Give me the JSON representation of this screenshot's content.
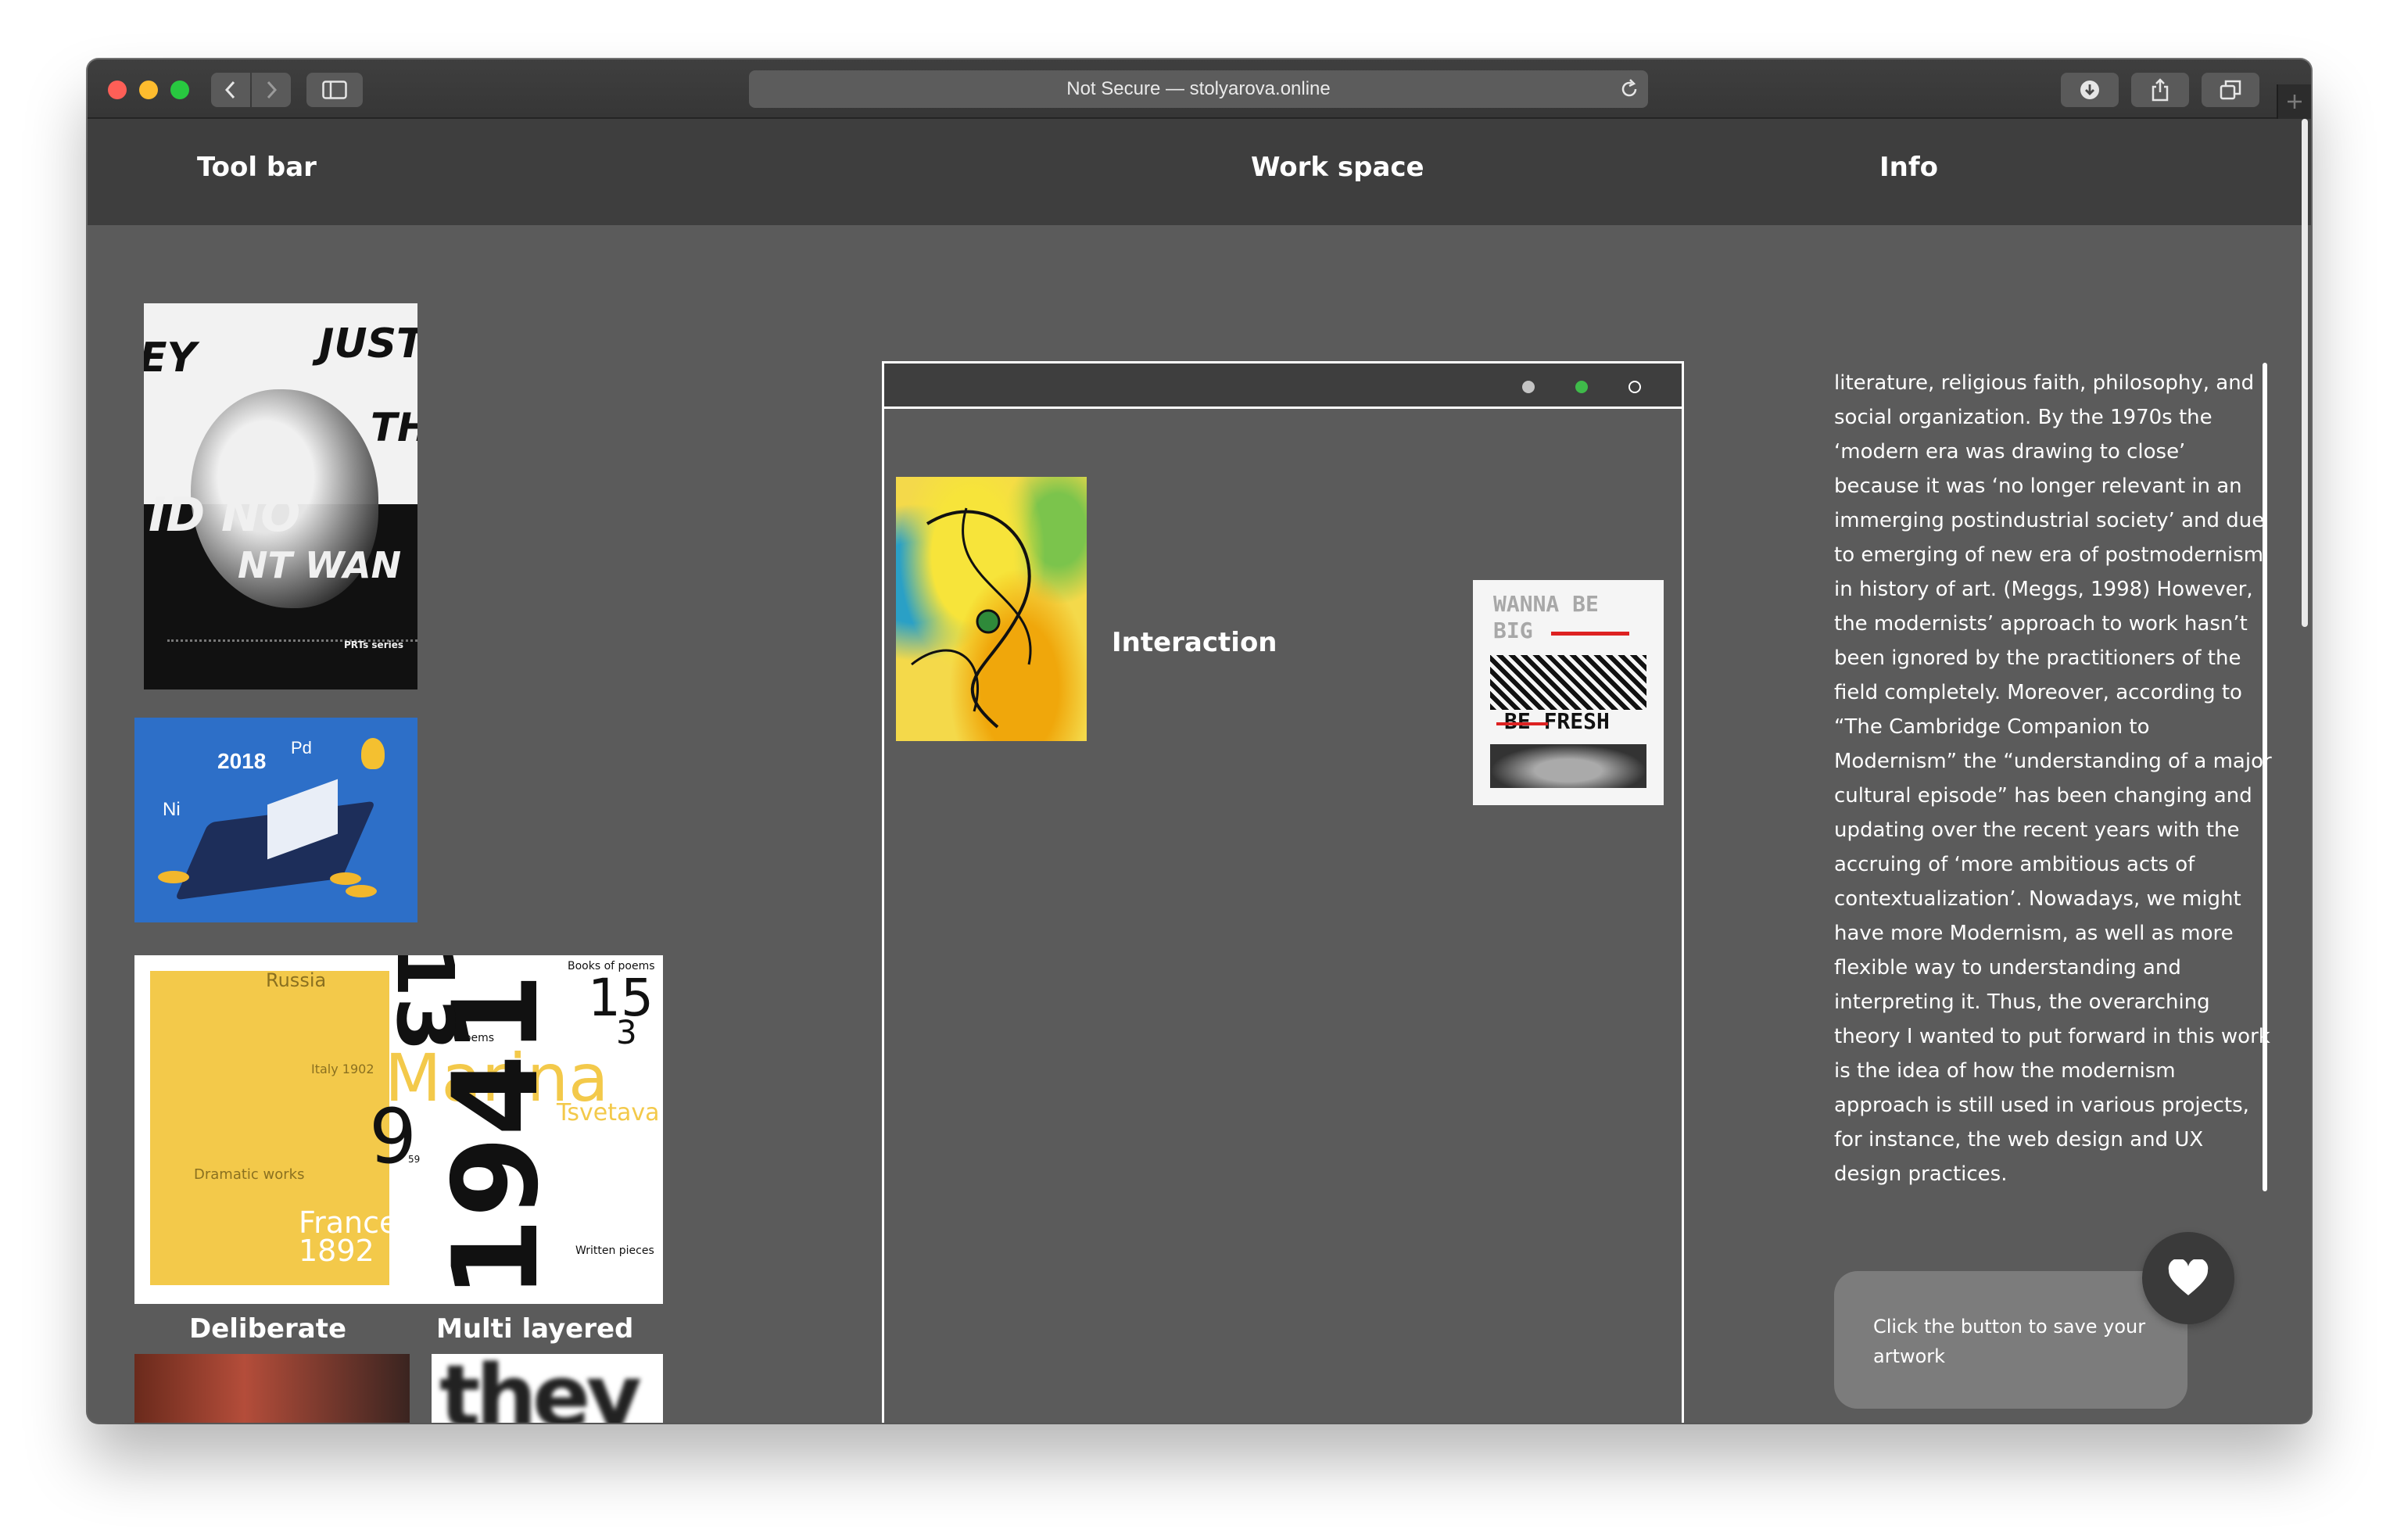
{
  "browser": {
    "url_text": "Not Secure — stolyarova.online",
    "icons": [
      "back-icon",
      "forward-icon",
      "sidebar-icon",
      "reload-icon",
      "download-icon",
      "share-icon",
      "tabs-icon",
      "plus-icon"
    ]
  },
  "header": {
    "tabs": [
      {
        "label": "Tool bar"
      },
      {
        "label": "Work space"
      },
      {
        "label": "Info"
      }
    ]
  },
  "toolbar": {
    "poster1_text": [
      "EY",
      "JUST",
      "TH",
      "ID NO",
      "NT WAN",
      "PRTs series"
    ],
    "poster2_text": [
      "2018",
      "Pd",
      "Ni"
    ],
    "poster3_text": [
      "Russia",
      "Books of poems",
      "15",
      "3",
      "Marina",
      "Tsvetava",
      "Poems",
      "Italy 1902",
      "9",
      "59",
      "Dramatic works",
      "France 1915",
      "1892",
      "1941",
      "Written pieces",
      "13"
    ],
    "captions": [
      "Deliberate",
      "Multi layered"
    ]
  },
  "workspace": {
    "title": "Interaction",
    "dots": [
      "#c4c4c4",
      "#3fba4a",
      "outline"
    ],
    "poster_text": [
      "WANNA BE",
      "BIG",
      "BE FRESH"
    ]
  },
  "info": {
    "body": "literature, religious faith, philosophy, and social organization. By the 1970s the ‘modern era was drawing to close’ because it was ‘no longer relevant in an immerging postindustrial society’ and due to emerging of new era of postmodernism in history of art. (Meggs, 1998) However, the modernists’ approach to work hasn’t been ignored by the practitioners of the field completely. Moreover, according to “The Cambridge Companion to Modernism” the “understanding of a major cultural episode” has been changing and updating over the recent years with the accruing of ‘more ambitious acts of contextualization’. Nowadays, we might have more Modernism, as well as more flexible way to understanding and interpreting it. Thus, the overarching theory I wanted to put forward in this work is the idea of how the modernism approach is still used in various projects, for instance, the web design and UX design practices.",
    "save_text": "Click the button to save your artwork"
  },
  "colors": {
    "header_bg": "#3e3e3e",
    "page_bg": "#5b5b5b",
    "active_dot": "#3fba4a"
  }
}
